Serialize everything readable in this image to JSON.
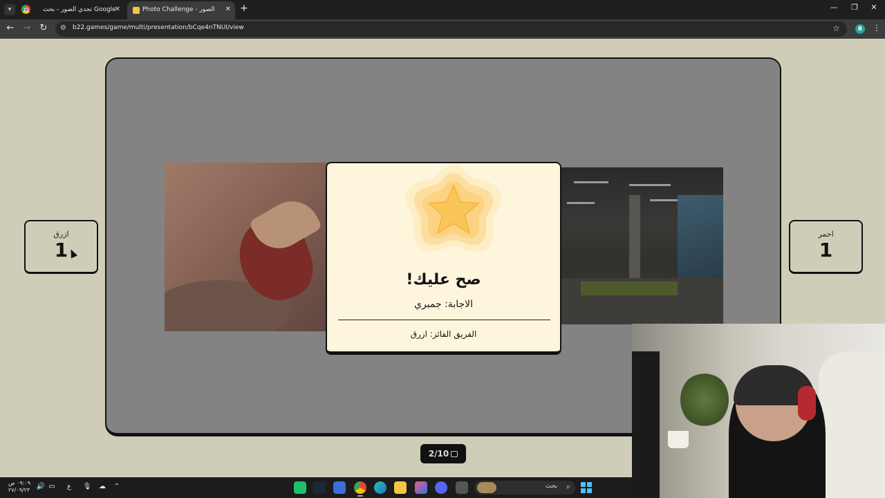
{
  "browser": {
    "tabs": [
      {
        "title": "تحدي الصور - بحث Google",
        "active": false
      },
      {
        "title": "Photo Challenge - تحدي الصور",
        "active": true
      }
    ],
    "url": "b22.games/game/multi/presentation/bCqe4nTNUI/view",
    "profile_initial": "B"
  },
  "game": {
    "teams": {
      "blue": {
        "name": "ازرق",
        "score": "1"
      },
      "red": {
        "name": "احمر",
        "score": "1"
      }
    },
    "result": {
      "title": "صح عليك!",
      "answer": "الاجابة: جمبري",
      "winner": "الفريق الفائز: ازرق"
    },
    "counter": "2/10"
  },
  "taskbar": {
    "search_label": "بحث",
    "time": "٠٩:٠٩ ص",
    "date": "٢٧/٠٩/٢٣",
    "input_lang": "ع"
  },
  "colors": {
    "page_bg": "#cfcdb8",
    "stage_bg": "#838383",
    "card_bg": "#fdf6dd",
    "star_fill": "#fbc863",
    "star_rings": [
      "#fde9b8",
      "#fbd98f",
      "#fcc978"
    ]
  }
}
